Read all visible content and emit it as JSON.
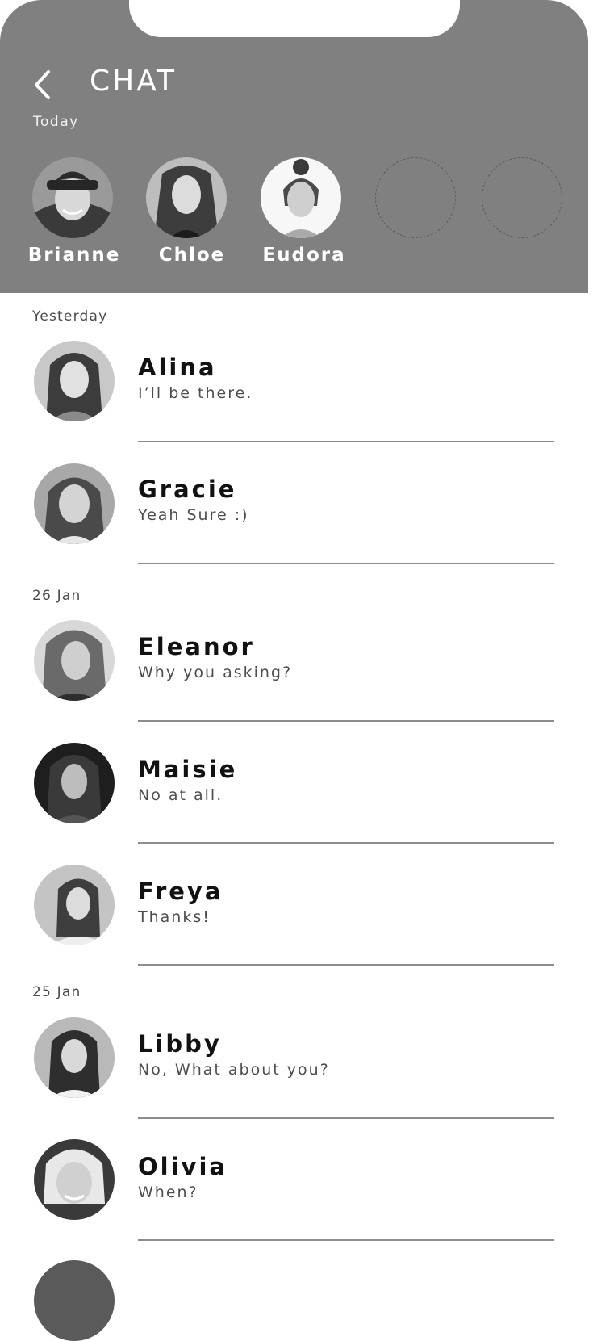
{
  "header": {
    "title": "CHAT",
    "today_label": "Today",
    "bg_color": "#808080"
  },
  "stories": [
    {
      "name": "Brianne",
      "avatar": "brianne-avatar"
    },
    {
      "name": "Chloe",
      "avatar": "chloe-avatar"
    },
    {
      "name": "Eudora",
      "avatar": "eudora-avatar"
    }
  ],
  "sections": {
    "yesterday": "Yesterday",
    "jan26": "26 Jan",
    "jan25": "25 Jan"
  },
  "chats": [
    {
      "name": "Alina",
      "message": "I’ll be there."
    },
    {
      "name": "Gracie",
      "message": "Yeah Sure :)"
    },
    {
      "name": "Eleanor",
      "message": "Why you asking?"
    },
    {
      "name": "Maisie",
      "message": "No at all."
    },
    {
      "name": "Freya",
      "message": "Thanks!"
    },
    {
      "name": "Libby",
      "message": "No, What about you?"
    },
    {
      "name": "Olivia",
      "message": "When?"
    }
  ]
}
